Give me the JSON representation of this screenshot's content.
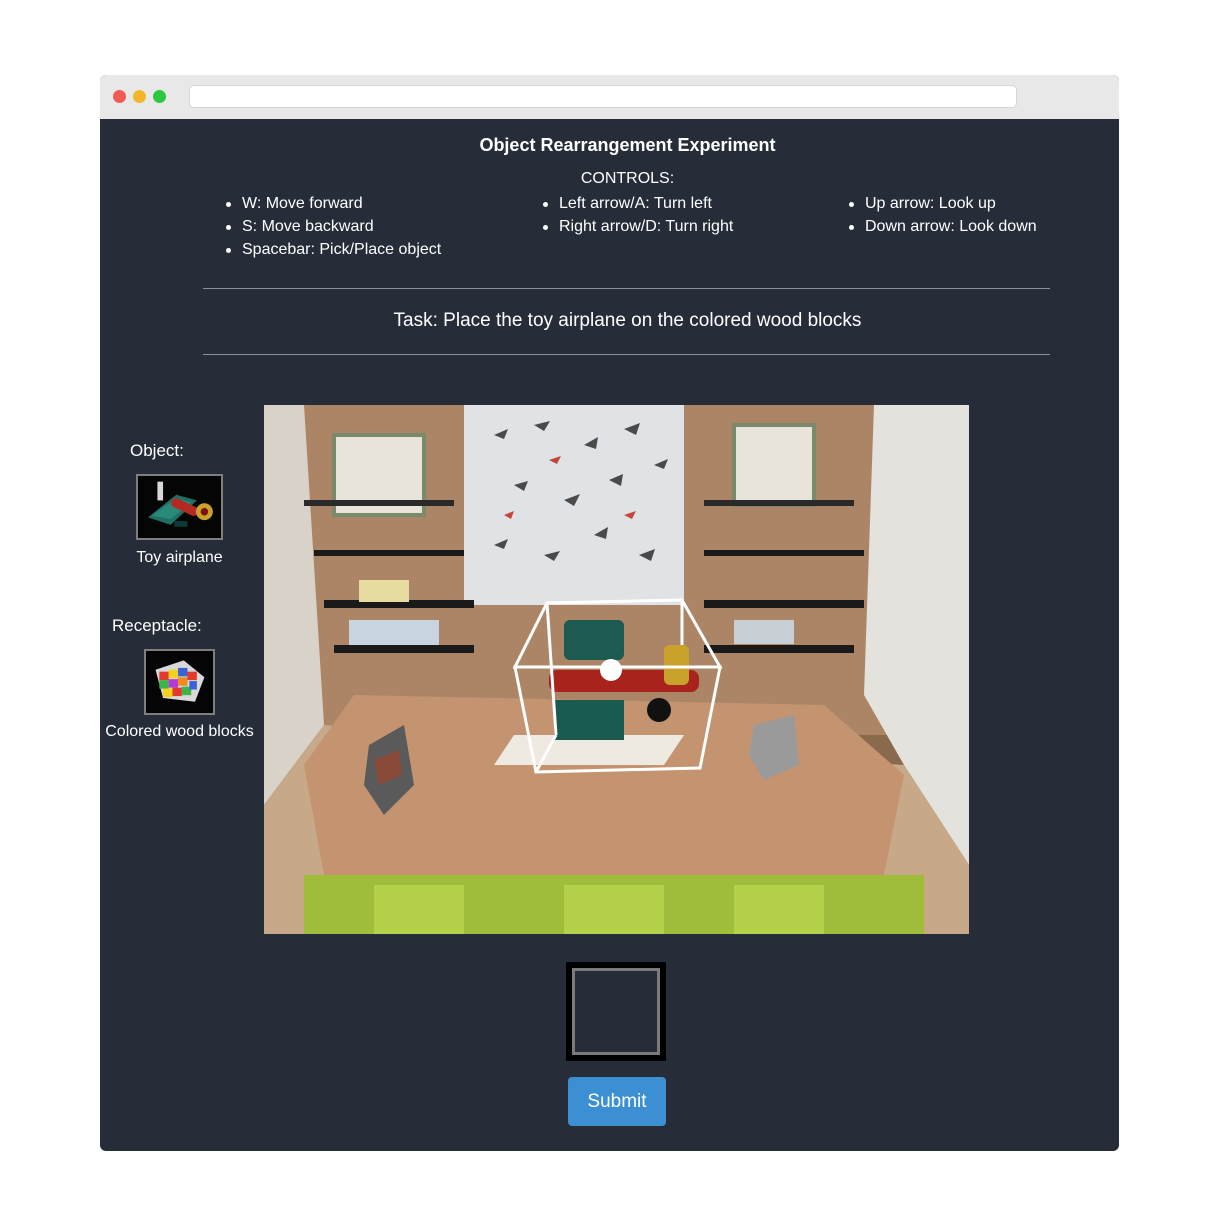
{
  "window": {
    "url": ""
  },
  "header": {
    "title": "Object Rearrangement Experiment",
    "controls_label": "CONTROLS:"
  },
  "controls": {
    "column1": [
      "W: Move forward",
      "S: Move backward",
      "Spacebar: Pick/Place object"
    ],
    "column2": [
      "Left arrow/A: Turn left",
      "Right arrow/D: Turn right"
    ],
    "column3": [
      "Up arrow: Look up",
      "Down arrow: Look down"
    ]
  },
  "task": {
    "text": "Task: Place the toy airplane on the colored wood blocks"
  },
  "sidebar": {
    "object_label": "Object:",
    "object_name": "Toy airplane",
    "receptacle_label": "Receptacle:",
    "receptacle_name": "Colored wood blocks"
  },
  "actions": {
    "submit_label": "Submit"
  },
  "colors": {
    "background": "#262c38",
    "submit_button": "#3c8fd3"
  },
  "icons": {
    "object_thumbnail": "toy-airplane-thumbnail",
    "receptacle_thumbnail": "wood-blocks-thumbnail"
  }
}
